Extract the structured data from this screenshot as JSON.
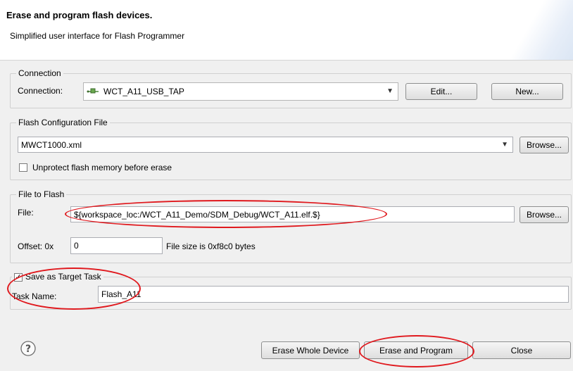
{
  "header": {
    "title": "Erase and program flash devices.",
    "subtitle": "Simplified user interface for Flash Programmer"
  },
  "connection": {
    "group_title": "Connection",
    "label": "Connection:",
    "value": "WCT_A11_USB_TAP",
    "icon": "usb-connection-icon",
    "edit_label": "Edit...",
    "new_label": "New..."
  },
  "flash_config": {
    "group_title": "Flash Configuration File",
    "value": "MWCT1000.xml",
    "browse_label": "Browse...",
    "unprotect_label": "Unprotect flash memory before erase",
    "unprotect_checked": false
  },
  "file_to_flash": {
    "group_title": "File to Flash",
    "file_label": "File:",
    "file_value": "${workspace_loc:/WCT_A11_Demo/SDM_Debug/WCT_A11.elf.$}",
    "browse_label": "Browse...",
    "offset_label": "Offset: 0x",
    "offset_value": "0",
    "file_size_text": "File size is 0xf8c0 bytes"
  },
  "target_task": {
    "save_label": "Save as Target Task",
    "save_checked": true,
    "task_name_label": "Task Name:",
    "task_name_value": "Flash_A11"
  },
  "footer": {
    "help_icon": "help-icon",
    "erase_whole_label": "Erase Whole Device",
    "erase_program_label": "Erase and Program",
    "close_label": "Close"
  },
  "colors": {
    "annotation": "#e0191e",
    "dialog_bg": "#f0f0f0",
    "header_bg": "#ffffff"
  }
}
